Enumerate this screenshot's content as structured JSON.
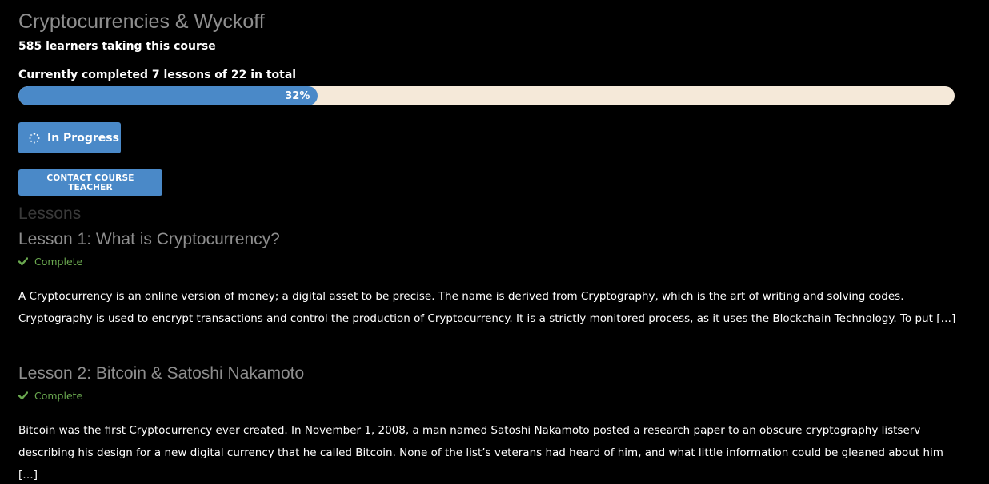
{
  "course": {
    "title": "Cryptocurrencies & Wyckoff",
    "learners_text": "585 learners taking this course",
    "completed_text": "Currently completed 7 lessons of 22 in total",
    "progress_percent": 32,
    "progress_label": "32%",
    "status_label": "In Progress",
    "contact_label": "CONTACT COURSE TEACHER"
  },
  "colors": {
    "accent": "#4a89c8",
    "progress_track": "#f5e9d9",
    "complete_green": "#6aa84f",
    "title_gray": "#8e8e8e"
  },
  "lessons_heading": "Lessons",
  "lessons": [
    {
      "title": "Lesson 1: What is Cryptocurrency?",
      "status": "Complete",
      "excerpt": "A Cryptocurrency is an online version of money; a digital asset to be precise.  The name is derived from Cryptography, which is the art of writing and solving codes.  Cryptography is used to encrypt transactions and control the production of Cryptocurrency.  It is a strictly monitored process, as it uses the Blockchain Technology. To put ",
      "more": "[…]"
    },
    {
      "title": "Lesson 2: Bitcoin & Satoshi Nakamoto",
      "status": "Complete",
      "excerpt": "Bitcoin was the first Cryptocurrency ever created.  In November 1, 2008, a man named Satoshi Nakamoto posted a research paper to an obscure cryptography listserv describing his design for a new digital currency that he called Bitcoin.  None of the list’s veterans had heard of him, and what little information could be gleaned about him ",
      "more": "[…]"
    }
  ],
  "icons": {
    "status": "spinner-icon",
    "complete": "check-icon"
  }
}
